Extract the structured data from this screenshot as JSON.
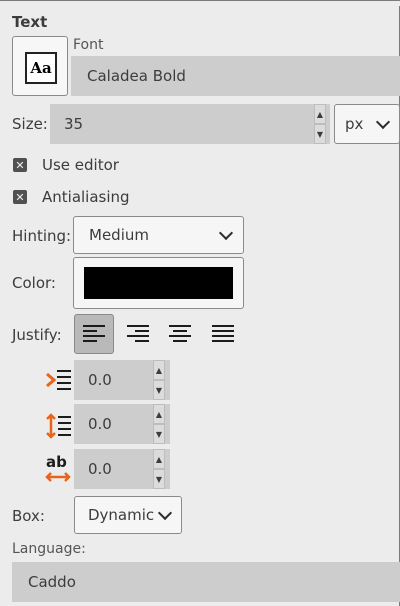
{
  "panel": {
    "title": "Text"
  },
  "font": {
    "label": "Font",
    "preview_glyph": "Aa",
    "value": "Caladea Bold"
  },
  "size": {
    "label": "Size:",
    "value": "35",
    "unit": "px",
    "spin_up": "▲",
    "spin_down": "▼"
  },
  "options": {
    "use_editor": {
      "label": "Use editor",
      "checked": true,
      "mark": "✕"
    },
    "antialiasing": {
      "label": "Antialiasing",
      "checked": true,
      "mark": "✕"
    }
  },
  "hinting": {
    "label": "Hinting:",
    "value": "Medium"
  },
  "color": {
    "label": "Color:",
    "swatch": "#000000"
  },
  "justify": {
    "label": "Justify:",
    "buttons": [
      "justify-left",
      "justify-right",
      "justify-center",
      "justify-fill"
    ],
    "active": "justify-left"
  },
  "spacing": {
    "indent": {
      "icon": "indent-icon",
      "value": "0.0"
    },
    "line_spacing": {
      "icon": "line-spacing-icon",
      "value": "0.0"
    },
    "letter_spacing": {
      "icon": "letter-spacing-icon",
      "glyph": "ab",
      "value": "0.0"
    },
    "spin_up": "▲",
    "spin_down": "▼"
  },
  "box": {
    "label": "Box:",
    "value": "Dynamic"
  },
  "language": {
    "label": "Language:",
    "value": "Caddo"
  },
  "colors": {
    "accent_orange": "#e8641b",
    "field_bg": "#cdcdcd",
    "panel_bg": "#ececec"
  }
}
